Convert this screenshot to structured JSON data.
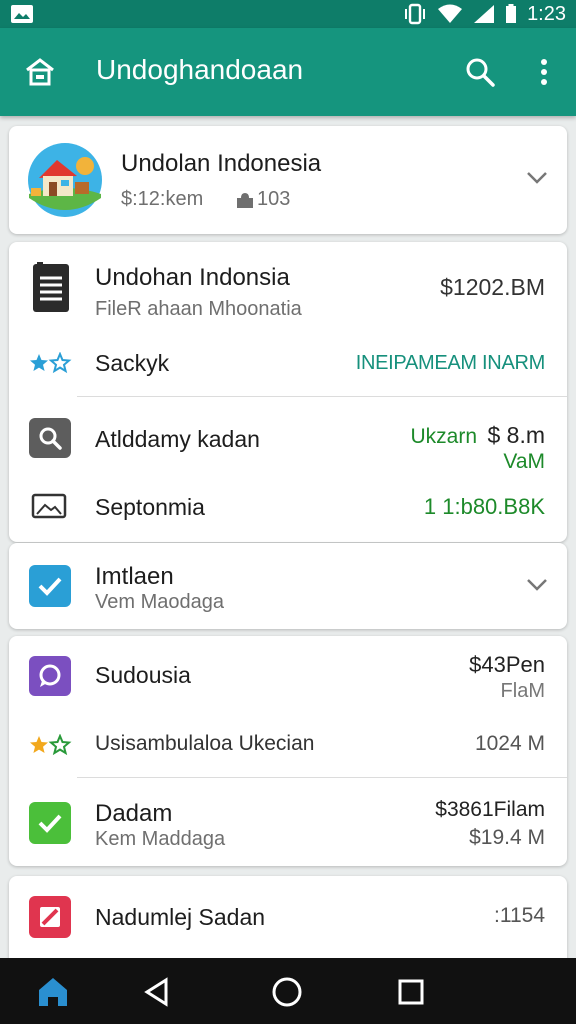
{
  "status_bar": {
    "time": "1:23",
    "icons": [
      "image-notification-icon",
      "vibrate-icon",
      "wifi-icon",
      "signal-icon",
      "battery-icon"
    ]
  },
  "app_bar": {
    "title": "Undoghandoaan",
    "icons": [
      "home-icon",
      "search-icon",
      "more-vert-icon"
    ]
  },
  "header_card": {
    "title": "Undolan Indonesia",
    "subtitle": "$:12:kem",
    "count": "103",
    "icons": [
      "app-logo-illustration",
      "puzzle-icon",
      "chevron-down-icon"
    ]
  },
  "group1": {
    "row1": {
      "title": "Undohan Indonsia",
      "subtitle": "FileR ahaan Mhoonatia",
      "value": "$1202.BM"
    },
    "row2": {
      "label": "Sackyk",
      "value": "INEIPAMEAM INARM"
    },
    "row3": {
      "label": "Atlddamy kadan",
      "value_green": "Ukzarn",
      "value": "$ 8.m",
      "value2": "VaM"
    },
    "row4": {
      "label": "Septonmia",
      "value": "1 1:b80.B8K"
    }
  },
  "group2": {
    "title": "Imtlaen",
    "subtitle": "Vem Maodaga"
  },
  "group3": {
    "row1": {
      "label": "Sudousia",
      "value": "$43Pen",
      "value2": "FlaM"
    },
    "row2": {
      "label": "Usisambulaloa Ukecian",
      "value": "1024 M"
    },
    "row3": {
      "title": "Dadam",
      "subtitle": "Kem Maddaga",
      "value": "$3861Filam",
      "value2": "$19.4 M"
    }
  },
  "group4": {
    "row1": {
      "label": "Nadumlej Sadan",
      "value": ":1154"
    }
  },
  "nav_bar": {
    "icons": [
      "home-nav-icon",
      "back-icon",
      "home-circle-icon",
      "recents-icon"
    ]
  },
  "colors": {
    "status_bar": "#0e7d69",
    "app_bar": "#15957e",
    "green_text": "#1d8a2a",
    "teal_text": "#16907c",
    "blue_check": "#2a9fd6",
    "purple_chat": "#7b4fc0",
    "green_check": "#4bbf3a",
    "red_tile": "#e0354f"
  }
}
